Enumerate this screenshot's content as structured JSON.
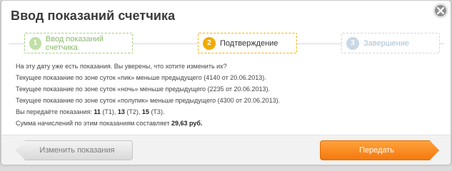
{
  "dialog": {
    "title": "Ввод показаний счетчика",
    "close_icon": "close-icon"
  },
  "steps": [
    {
      "number": "1",
      "label": "Ввод показаний счетчика",
      "state": "done"
    },
    {
      "number": "2",
      "label": "Подтверждение",
      "state": "active"
    },
    {
      "number": "3",
      "label": "Завершение",
      "state": "pending"
    }
  ],
  "content": {
    "line1": "На эту дату уже есть показания. Вы уверены, что хотите изменить их?",
    "line2": "Текущее показание по зоне суток «пик» меньше предыдущего (4140 от 20.06.2013).",
    "line3": "Текущее показание по зоне суток «ночь» меньше предыдущего (2235 от 20.06.2013).",
    "line4": "Текущее показание по зоне суток «полупик» меньше предыдущего (4300 от 20.06.2013).",
    "readings_prefix": "Вы передаёте показания: ",
    "t1_value": "11",
    "t1_label": " (Т1), ",
    "t2_value": "13",
    "t2_label": " (Т2), ",
    "t3_value": "15",
    "t3_label": " (Т3).",
    "sum_prefix": "Сумма начислений по этим показаниям составляет ",
    "sum_value": "29,63 руб."
  },
  "footer": {
    "back_label": "Изменить показания",
    "next_label": "Передать"
  },
  "colors": {
    "accent_orange": "#f4790f",
    "active_step": "#f1ac00",
    "done_step": "#88b96a",
    "pending_step": "#a7bfd4"
  }
}
